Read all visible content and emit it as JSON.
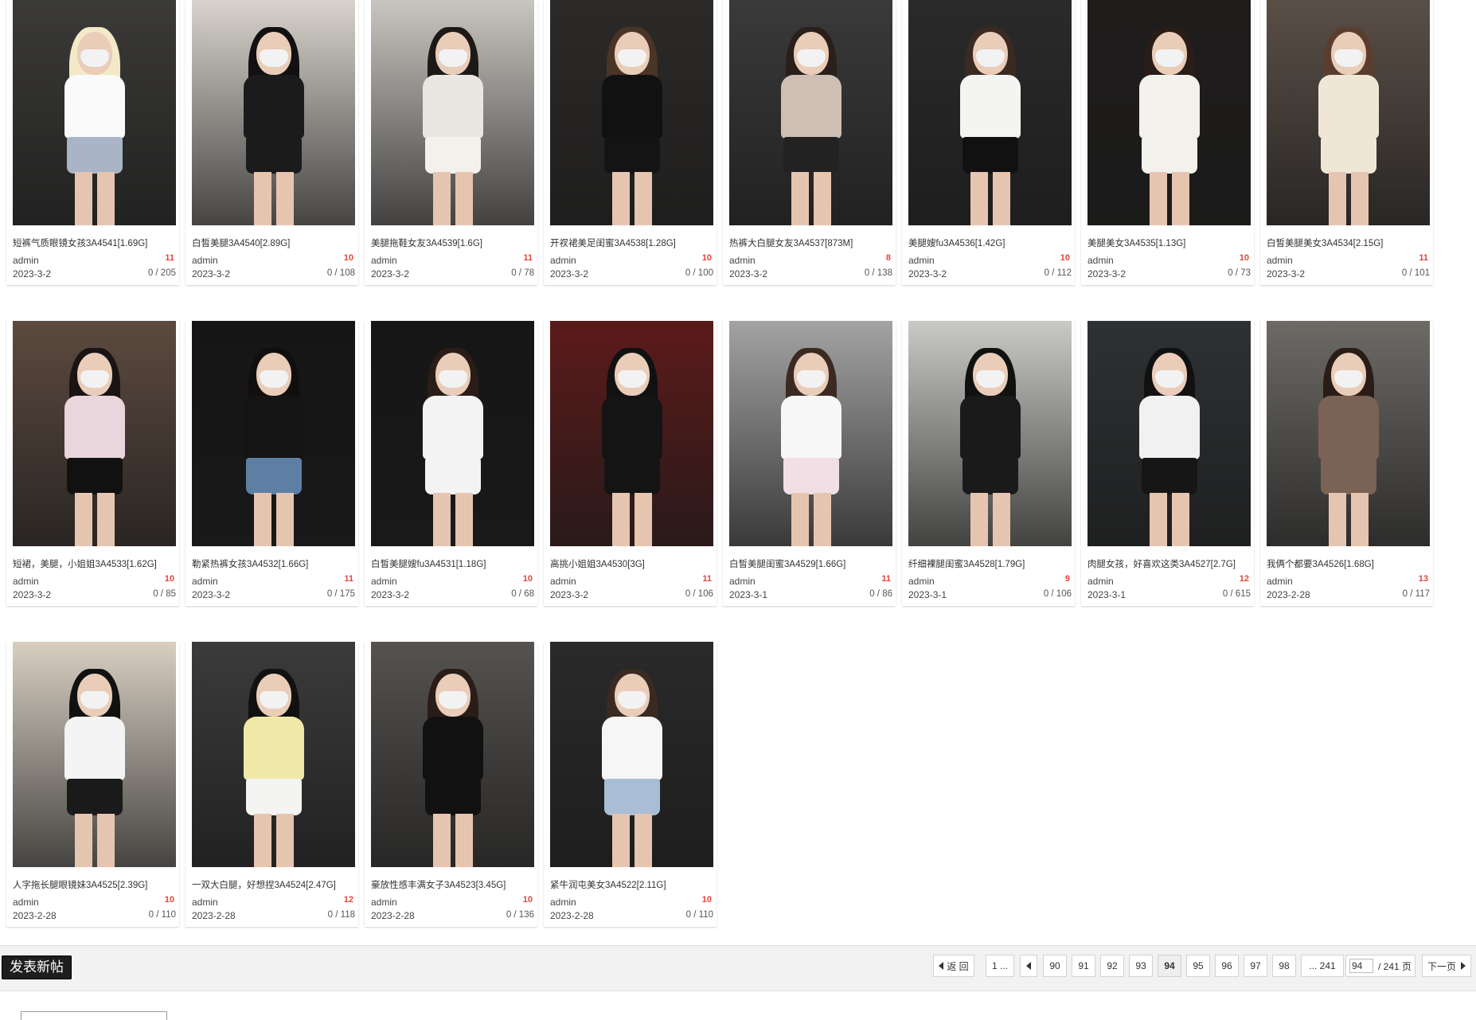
{
  "threads": [
    {
      "title": "短裤气质眼镜女孩3A4541[1.69G]",
      "author": "admin",
      "date": "2023-3-2",
      "pics": "11",
      "stats": "0 / 205"
    },
    {
      "title": "白皙美腿3A4540[2.89G]",
      "author": "admin",
      "date": "2023-3-2",
      "pics": "10",
      "stats": "0 / 108"
    },
    {
      "title": "美腿拖鞋女友3A4539[1.6G]",
      "author": "admin",
      "date": "2023-3-2",
      "pics": "11",
      "stats": "0 / 78"
    },
    {
      "title": "开衩裙美足闺蜜3A4538[1.28G]",
      "author": "admin",
      "date": "2023-3-2",
      "pics": "10",
      "stats": "0 / 100"
    },
    {
      "title": "热裤大白腿女友3A4537[873M]",
      "author": "admin",
      "date": "2023-3-2",
      "pics": "8",
      "stats": "0 / 138"
    },
    {
      "title": "美腿嫂fu3A4536[1.42G]",
      "author": "admin",
      "date": "2023-3-2",
      "pics": "10",
      "stats": "0 / 112"
    },
    {
      "title": "美腿美女3A4535[1.13G]",
      "author": "admin",
      "date": "2023-3-2",
      "pics": "10",
      "stats": "0 / 73"
    },
    {
      "title": "白皙美腿美女3A4534[2.15G]",
      "author": "admin",
      "date": "2023-3-2",
      "pics": "11",
      "stats": "0 / 101"
    },
    {
      "title": "短裙，美腿，小姐姐3A4533[1.62G]",
      "author": "admin",
      "date": "2023-3-2",
      "pics": "10",
      "stats": "0 / 85"
    },
    {
      "title": "勒紧热裤女孩3A4532[1.66G]",
      "author": "admin",
      "date": "2023-3-2",
      "pics": "11",
      "stats": "0 / 175"
    },
    {
      "title": "白皙美腿嫂fu3A4531[1.18G]",
      "author": "admin",
      "date": "2023-3-2",
      "pics": "10",
      "stats": "0 / 68"
    },
    {
      "title": "高挑小姐姐3A4530[3G]",
      "author": "admin",
      "date": "2023-3-2",
      "pics": "11",
      "stats": "0 / 106"
    },
    {
      "title": "白皙美腿闺蜜3A4529[1.66G]",
      "author": "admin",
      "date": "2023-3-1",
      "pics": "11",
      "stats": "0 / 86"
    },
    {
      "title": "纤细裸腿闺蜜3A4528[1.79G]",
      "author": "admin",
      "date": "2023-3-1",
      "pics": "9",
      "stats": "0 / 106"
    },
    {
      "title": "肉腿女孩，好喜欢这类3A4527[2.7G]",
      "author": "admin",
      "date": "2023-3-1",
      "pics": "12",
      "stats": "0 / 615"
    },
    {
      "title": "我俩个都要3A4526[1.68G]",
      "author": "admin",
      "date": "2023-2-28",
      "pics": "13",
      "stats": "0 / 117"
    },
    {
      "title": "人字拖长腿眼镜妹3A4525[2.39G]",
      "author": "admin",
      "date": "2023-2-28",
      "pics": "10",
      "stats": "0 / 110"
    },
    {
      "title": "一双大白腿，好想捏3A4524[2.47G]",
      "author": "admin",
      "date": "2023-2-28",
      "pics": "12",
      "stats": "0 / 118"
    },
    {
      "title": "豪放性感丰满女子3A4523[3.45G]",
      "author": "admin",
      "date": "2023-2-28",
      "pics": "10",
      "stats": "0 / 136"
    },
    {
      "title": "紧牛润屯美女3A4522[2.11G]",
      "author": "admin",
      "date": "2023-2-28",
      "pics": "10",
      "stats": "0 / 110"
    }
  ],
  "toolbar": {
    "new_post_label": "发表新帖"
  },
  "pagination": {
    "back_label": "返 回",
    "first_label": "1 ...",
    "pages": [
      "90",
      "91",
      "92",
      "93",
      "94",
      "95",
      "96",
      "97",
      "98"
    ],
    "current": "94",
    "last_label": "... 241",
    "jump_value": "94",
    "total_label": "/ 241 页",
    "next_label": "下一页"
  }
}
